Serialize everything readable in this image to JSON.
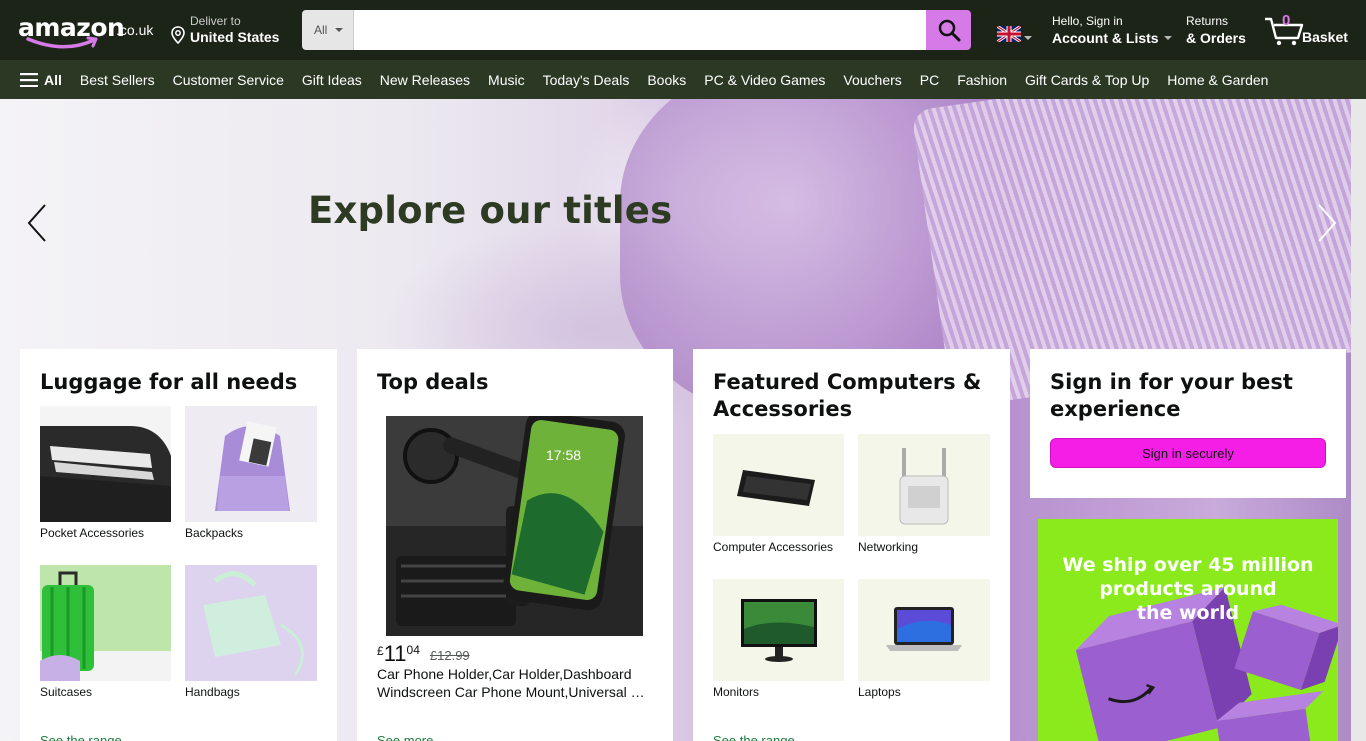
{
  "header": {
    "logo_text": "amazon",
    "logo_tld": ".co.uk",
    "deliver_line1": "Deliver to",
    "deliver_line2": "United States",
    "search_category": "All",
    "search_placeholder": "",
    "account_line1": "Hello, Sign in",
    "account_line2": "Account & Lists",
    "returns_line1": "Returns",
    "returns_line2": "& Orders",
    "basket_count": "0",
    "basket_label": "Basket"
  },
  "nav": {
    "all_label": "All",
    "items": [
      "Best Sellers",
      "Customer Service",
      "Gift Ideas",
      "New Releases",
      "Music",
      "Today's Deals",
      "Books",
      "PC & Video Games",
      "Vouchers",
      "PC",
      "Fashion",
      "Gift Cards & Top Up",
      "Home & Garden"
    ]
  },
  "hero": {
    "title": "Explore our titles"
  },
  "cards": {
    "luggage": {
      "title": "Luggage for all needs",
      "tiles": [
        "Pocket Accessories",
        "Backpacks",
        "Suitcases",
        "Handbags"
      ],
      "link": "See the range"
    },
    "deals": {
      "title": "Top deals",
      "price_currency": "£",
      "price_whole": "11",
      "price_fraction": "04",
      "price_old": "£12.99",
      "desc_line1": "Car Phone Holder,Car Holder,Dashboard",
      "desc_line2": "Windscreen Car Phone Mount,Universal Car...",
      "phone_time": "17:58",
      "link": "See more"
    },
    "computers": {
      "title_line1": "Featured Computers &",
      "title_line2": "Accessories",
      "tiles": [
        "Computer Accessories",
        "Networking",
        "Monitors",
        "Laptops"
      ],
      "link": "See the range"
    },
    "signin": {
      "title_line1": "Sign in for your best",
      "title_line2": "experience",
      "button": "Sign in securely"
    },
    "promo": {
      "line1": "We ship over 45 million",
      "line2": "products around",
      "line3": "the world"
    }
  },
  "colors": {
    "header_bg": "#1c2417",
    "nav_bg": "#2b3924",
    "accent": "#d67ae8",
    "signin_button": "#f51ee7",
    "promo_bg": "#8bea1b",
    "link": "#1a7a3c"
  }
}
